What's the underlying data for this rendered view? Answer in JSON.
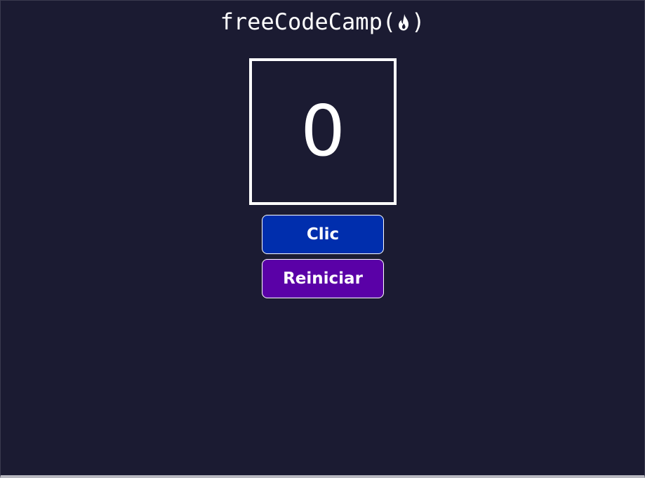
{
  "header": {
    "logo_text": "freeCodeCamp",
    "open_paren": "(",
    "close_paren": ")",
    "logo_icon": "flame-icon"
  },
  "counter": {
    "value": "0"
  },
  "buttons": {
    "click_label": "Clic",
    "reset_label": "Reiniciar"
  },
  "colors": {
    "background": "#1b1b32",
    "click_button": "#002ead",
    "reset_button": "#5a01a7",
    "foreground": "#ffffff"
  }
}
